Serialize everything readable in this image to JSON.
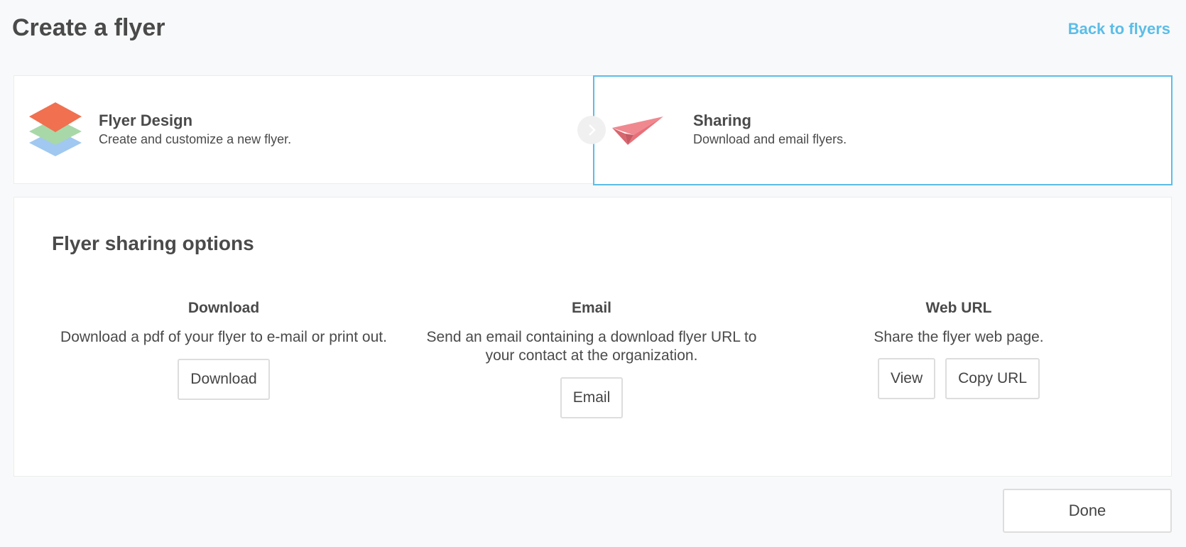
{
  "header": {
    "title": "Create a flyer",
    "back_link": "Back to flyers"
  },
  "steps": [
    {
      "title": "Flyer Design",
      "description": "Create and customize a new flyer.",
      "icon": "layers-icon",
      "active": false
    },
    {
      "title": "Sharing",
      "description": "Download and email flyers.",
      "icon": "paper-plane-icon",
      "active": true
    }
  ],
  "sharing": {
    "title": "Flyer sharing options",
    "options": [
      {
        "title": "Download",
        "description": "Download a pdf of your flyer to e-mail or print out.",
        "buttons": [
          "Download"
        ]
      },
      {
        "title": "Email",
        "description": "Send an email containing a download flyer URL to your contact at the organization.",
        "buttons": [
          "Email"
        ]
      },
      {
        "title": "Web URL",
        "description": "Share the flyer web page.",
        "buttons": [
          "View",
          "Copy URL"
        ]
      }
    ]
  },
  "footer": {
    "done_label": "Done"
  },
  "colors": {
    "accent": "#5bbde8",
    "layer_top": "#f07050",
    "layer_middle": "#a8d8a8",
    "layer_bottom": "#a0c8f0",
    "plane": "#e8707a"
  }
}
